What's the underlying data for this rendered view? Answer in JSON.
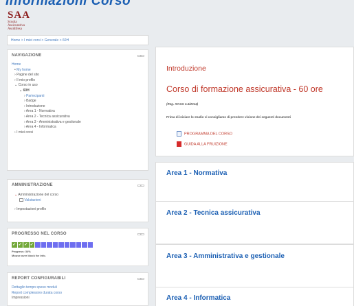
{
  "header": {
    "top_title": "Informazioni Corso",
    "logo_abbr": "SAA",
    "logo_lines": [
      "Scuola",
      "Assicurativa",
      "Assidifesa"
    ]
  },
  "breadcrumb": "Home  >  I miei corsi  >  Generale  >  60H",
  "navigation": {
    "title": "NAVIGAZIONE",
    "home": "Home",
    "my_home": "My home",
    "site_pages": "Pagine del sito",
    "my_profile": "Il mio profilo",
    "current_course": "Corso in uso",
    "course": "60H",
    "participants": "Partecipanti",
    "badges": "Badge",
    "intro": "Introduzione",
    "area1": "Area 1 - Normativa",
    "area2": "Area 2 - Tecnica assicurativa",
    "area3": "Area 3 - Amministrativa e gestionale",
    "area4": "Area 4 - Informatica",
    "my_courses": "I miei corsi"
  },
  "administration": {
    "title": "AMMINISTRAZIONE",
    "course_admin": "Amministrazione del corso",
    "grades": "Valutazioni",
    "profile_settings": "Impostazioni profilo"
  },
  "progress": {
    "title": "PROGRESSO NEL CORSO",
    "completed": 4,
    "total": 14,
    "check": "✓",
    "progress_text": "Progress: 34%",
    "info_text": "Mouse over block for info."
  },
  "reports": {
    "title": "REPORT CONFIGURABILI",
    "item1": "Dettaglio tempo speso moduli",
    "item2": "Report complessivo durata corso",
    "item3": "Impressioni"
  },
  "main": {
    "intro_heading": "Introduzione",
    "course_title": "Corso di formazione assicurativa - 60 ore",
    "reg": "(Reg. IVASS n.6/2014)",
    "instruction": "Prima di iniziare lo studio vi consigliamo di prendere visione dei seguenti documenti",
    "doc1": "PROGRAMMA DEL CORSO",
    "doc2": "GUIDA ALLA FRUIZIONE",
    "sections": [
      "Area 1 - Normativa",
      "Area 2 - Tecnica assicurativa",
      "Area 3 - Amministrativa e gestionale",
      "Area 4 - Informatica"
    ]
  },
  "colors": {
    "accent_red": "#c0392b",
    "accent_blue": "#1b5fb3",
    "progress_done": "#73a839",
    "progress_todo": "#6e6ef0"
  }
}
